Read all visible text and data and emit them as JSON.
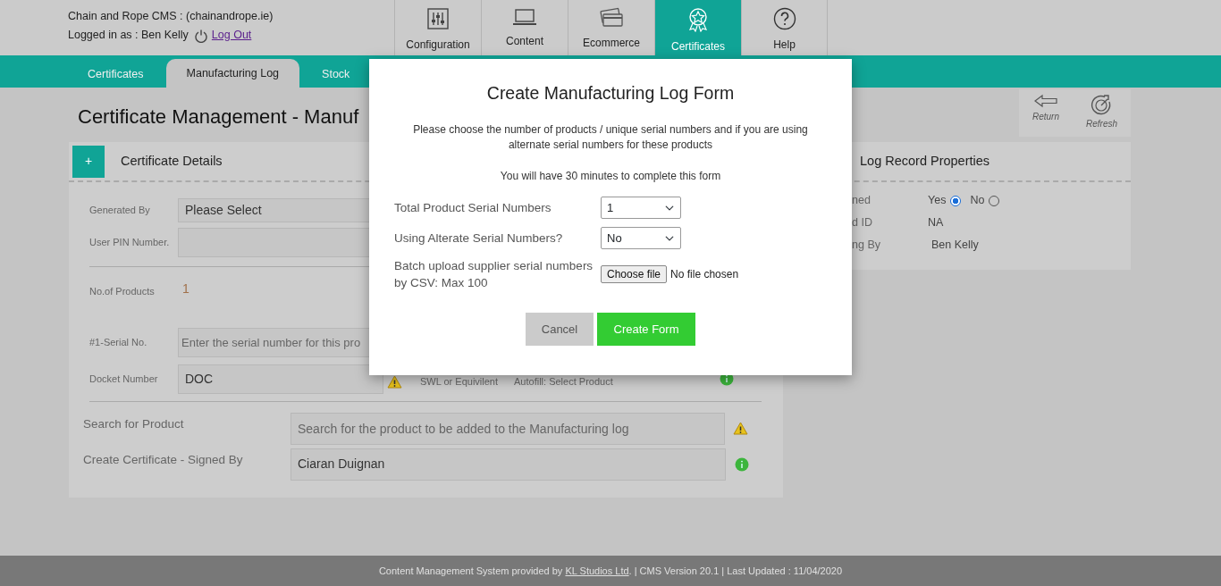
{
  "header": {
    "site": "Chain and Rope CMS : (chainandrope.ie)",
    "logged_in": "Logged in as : Ben Kelly",
    "logout": "Log Out"
  },
  "main_nav": [
    {
      "label": "Configuration",
      "kind": "sliders",
      "selected": false
    },
    {
      "label": "Content",
      "kind": "laptop",
      "selected": false
    },
    {
      "label": "Ecommerce",
      "kind": "cards",
      "selected": false
    },
    {
      "label": "Certificates",
      "kind": "award",
      "selected": true
    },
    {
      "label": "Help",
      "kind": "help",
      "selected": false
    }
  ],
  "sub_tabs": [
    {
      "label": "Certificates",
      "selected": false
    },
    {
      "label": "Manufacturing Log",
      "selected": true
    },
    {
      "label": "Stock",
      "selected": false
    }
  ],
  "page_title": "Certificate Management - Manuf",
  "toolbar": [
    {
      "label": "Return",
      "kind": "return"
    },
    {
      "label": "Refresh",
      "kind": "refresh"
    }
  ],
  "certificate_details": {
    "toggle": "+",
    "title": "Certificate Details",
    "generated_by": {
      "label": "Generated By",
      "value": "Please Select"
    },
    "user_pin": {
      "label": "User PIN Number."
    },
    "products": {
      "label": "No.of Products",
      "value": "1"
    },
    "serial": {
      "label": "#1-Serial No.",
      "placeholder": "Enter the serial number for this pro"
    },
    "docket": {
      "label": "Docket Number",
      "value": "DOC"
    },
    "swl": {
      "label": "SWL or Equivilent",
      "value": "Autofill: Select Product"
    },
    "search_product": {
      "label": "Search for Product",
      "placeholder": "Search for the product to be added to the Manufacturing log"
    },
    "signed_by": {
      "label": "Create Certificate - Signed By",
      "value": "Ciaran Duignan"
    }
  },
  "log_record": {
    "title": "Log Record Properties",
    "rows": [
      {
        "label": "ned",
        "kind": "radio",
        "options": [
          {
            "label": "Yes",
            "selected": true
          },
          {
            "label": "No",
            "selected": false
          }
        ]
      },
      {
        "label": "d ID",
        "kind": "text",
        "value": "NA"
      },
      {
        "label": "ng By",
        "kind": "text",
        "value": "Ben Kelly"
      }
    ]
  },
  "modal": {
    "title": "Create Manufacturing Log Form",
    "intro": "Please choose the number of products / unique serial numbers and if you are using alternate serial numbers for these products",
    "notice": "You will have 30 minutes to complete this form",
    "fields": [
      {
        "label": "Total Product Serial Numbers",
        "kind": "select",
        "value": "1"
      },
      {
        "label": "Using Alterate Serial Numbers?",
        "kind": "select",
        "value": "No"
      },
      {
        "label": "Batch upload supplier serial numbers by CSV: Max 100",
        "kind": "file",
        "button": "Choose file",
        "value": "No file chosen"
      }
    ],
    "buttons": [
      {
        "label": "Cancel",
        "kind": "secondary"
      },
      {
        "label": "Create Form",
        "kind": "primary"
      }
    ]
  },
  "footer": {
    "text": "Content Management System provided by ",
    "link": "KL Studios Ltd",
    "rest": ". | CMS Version 20.1 | Last Updated : 11/04/2020"
  }
}
